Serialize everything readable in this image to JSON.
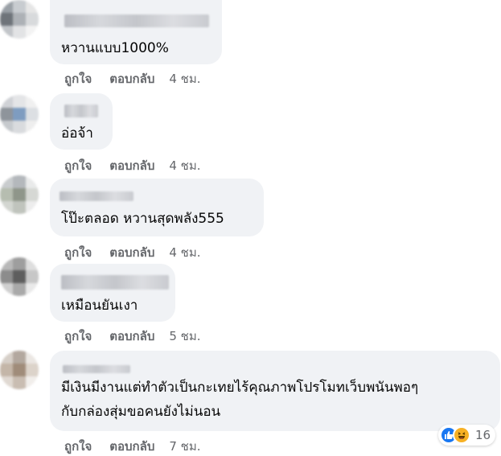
{
  "comments": [
    {
      "text_lines": [
        "หวานแบบ1000%"
      ],
      "like": "ถูกใจ",
      "reply": "ตอบกลับ",
      "time": "4 ชม."
    },
    {
      "text_lines": [
        "อ่อจ้า"
      ],
      "like": "ถูกใจ",
      "reply": "ตอบกลับ",
      "time": "4 ชม."
    },
    {
      "text_lines": [
        "โป๊ะตลอด หวานสุดพลัง555"
      ],
      "like": "ถูกใจ",
      "reply": "ตอบกลับ",
      "time": "4 ชม."
    },
    {
      "text_lines": [
        "เหมือนยันเงา"
      ],
      "like": "ถูกใจ",
      "reply": "ตอบกลับ",
      "time": "5 ชม."
    },
    {
      "text_lines": [
        "มีเงินมีงานแต่ทำตัวเป็นกะเทยไร้คุณภาพโปรโมทเว็บพนันพอๆ",
        "กับกล่องสุ่มขอคนยังไม่นอน"
      ],
      "like": "ถูกใจ",
      "reply": "ตอบกลับ",
      "time": "7 ชม.",
      "reactions": {
        "icons": [
          "like-icon",
          "haha-icon"
        ],
        "count": "16"
      }
    }
  ],
  "colors": {
    "bubble": "#f0f2f5",
    "action_text": "#65676b",
    "like_blue": "#1877f2",
    "haha_yellow": "#f7b125"
  }
}
